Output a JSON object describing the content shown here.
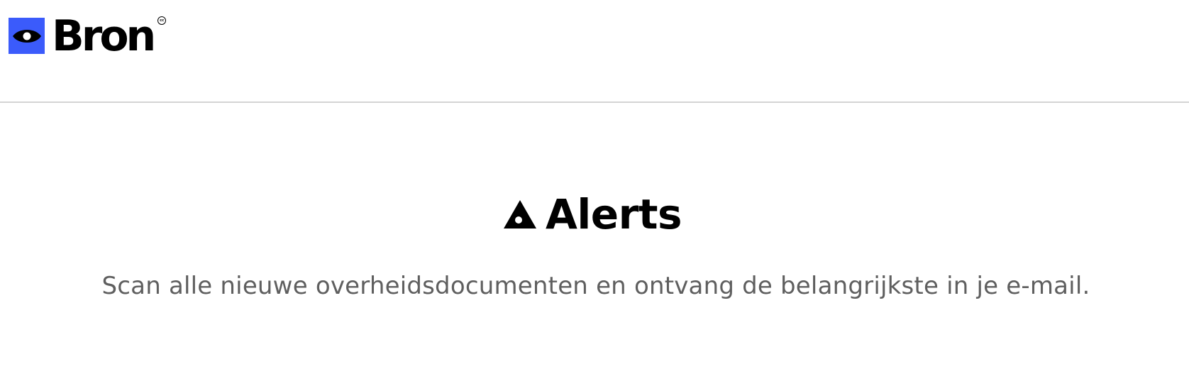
{
  "header": {
    "logo": {
      "wordmark": "Bron",
      "badge": "cc",
      "mark_icon": "eye-icon",
      "brand_color": "#3b5bfb"
    }
  },
  "main": {
    "title_icon": "alert-triangle-eye-icon",
    "title": "Alerts",
    "subtitle": "Scan alle nieuwe overheidsdocumenten en ontvang de belangrijkste in je e-mail."
  },
  "colors": {
    "text_primary": "#000000",
    "text_secondary": "#5f5f5f",
    "divider": "#d4d4d4",
    "background": "#ffffff"
  }
}
